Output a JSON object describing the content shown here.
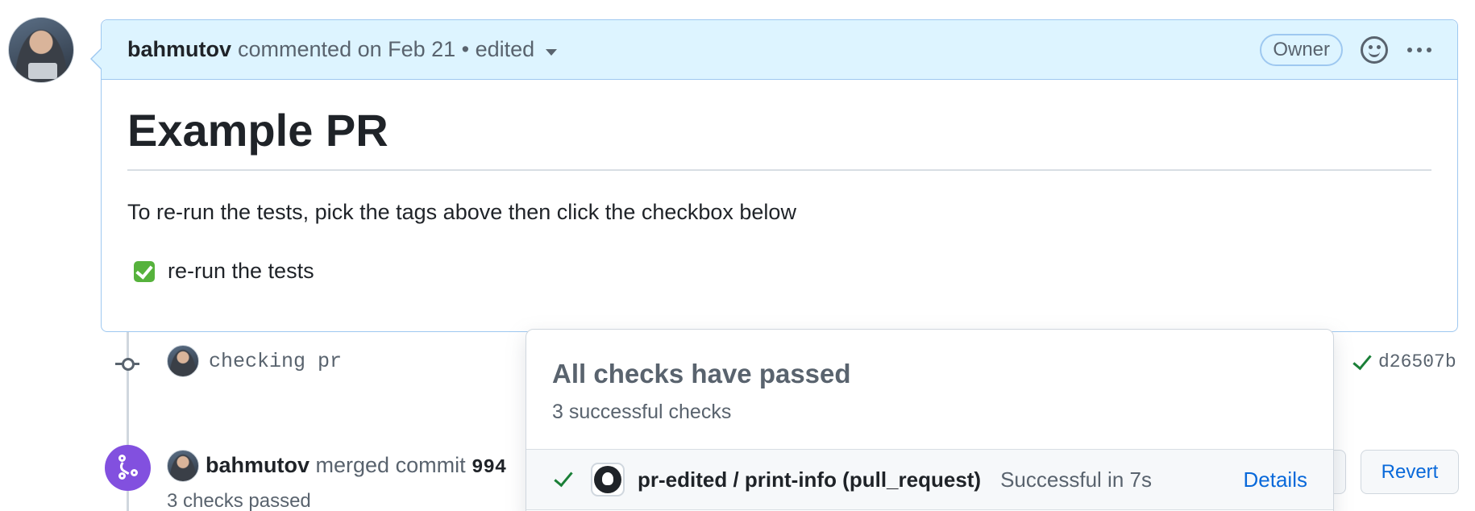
{
  "comment": {
    "author": "bahmutov",
    "meta": "commented on Feb 21 • edited",
    "badge": "Owner",
    "title": "Example PR",
    "text": "To re-run the tests, pick the tags above then click the checkbox below",
    "task_label": "re-run the tests",
    "task_checked": true
  },
  "commit": {
    "message": "checking pr",
    "sha": "d26507b"
  },
  "merge": {
    "author": "bahmutov",
    "action": "merged commit",
    "sha_visible": "994",
    "checks_summary": "3 checks passed",
    "revert_label": "Revert"
  },
  "checks_popover": {
    "title": "All checks have passed",
    "subtitle": "3 successful checks",
    "check_name": "pr-edited / print-info (pull_request)",
    "check_status": "Successful in 7s",
    "details_label": "Details"
  },
  "colors": {
    "accent": "#0969da",
    "success": "#1a7f37",
    "merged": "#8250df",
    "header_bg": "#ddf4ff"
  }
}
